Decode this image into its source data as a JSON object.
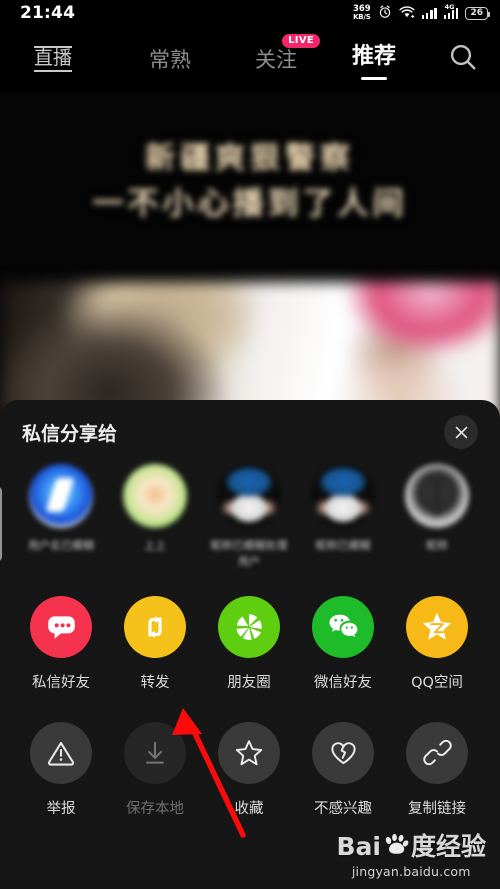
{
  "status_bar": {
    "time": "21:44",
    "net_speed_value": "369",
    "net_speed_unit": "KB/S",
    "battery_level": "26",
    "network_type": "4G",
    "icons": [
      "alarm-icon",
      "wifi-icon",
      "signal-icon",
      "signal-4g-icon",
      "battery-icon"
    ]
  },
  "top_nav": {
    "tabs": [
      {
        "label": "直播",
        "active": false,
        "badge": ""
      },
      {
        "label": "常熟",
        "active": false,
        "badge": ""
      },
      {
        "label": "关注",
        "active": false,
        "badge": "LIVE"
      },
      {
        "label": "推荐",
        "active": true,
        "badge": ""
      }
    ],
    "search_icon": "search-icon"
  },
  "video": {
    "title_line1": "新疆爽狠警察",
    "title_line2": "一不小心播到了人间"
  },
  "share_sheet": {
    "title": "私信分享给",
    "close_icon": "close-icon",
    "contacts": [
      {
        "name": "用户名已模糊"
      },
      {
        "name": "上上"
      },
      {
        "name": "昵称已模糊处理用户"
      },
      {
        "name": "昵称已模糊"
      },
      {
        "name": "昵称"
      }
    ],
    "actions_row1": [
      {
        "label": "私信好友",
        "icon": "chat-bubble-icon",
        "color": "#f5334f",
        "disabled": false
      },
      {
        "label": "转发",
        "icon": "repost-arrows-icon",
        "color": "#f5c21b",
        "disabled": false
      },
      {
        "label": "朋友圈",
        "icon": "moments-shutter-icon",
        "color": "#5fce10",
        "disabled": false
      },
      {
        "label": "微信好友",
        "icon": "wechat-icon",
        "color": "#1fbc2a",
        "disabled": false
      },
      {
        "label": "QQ空间",
        "icon": "qzone-star-icon",
        "color": "#f7b918",
        "disabled": false
      }
    ],
    "actions_row2": [
      {
        "label": "举报",
        "icon": "warning-triangle-icon",
        "color": "#3a3a3a",
        "disabled": false
      },
      {
        "label": "保存本地",
        "icon": "download-icon",
        "color": "#3a3a3a",
        "disabled": true
      },
      {
        "label": "收藏",
        "icon": "star-icon",
        "color": "#3a3a3a",
        "disabled": false
      },
      {
        "label": "不感兴趣",
        "icon": "broken-heart-icon",
        "color": "#3a3a3a",
        "disabled": false
      },
      {
        "label": "复制链接",
        "icon": "link-icon",
        "color": "#3a3a3a",
        "disabled": false
      }
    ]
  },
  "annotation": {
    "arrow_color": "#fb0b0b",
    "points_to": "转发"
  },
  "watermark": {
    "brand_left": "Bai",
    "brand_right": "度经验",
    "url": "jingyan.baidu.com"
  }
}
